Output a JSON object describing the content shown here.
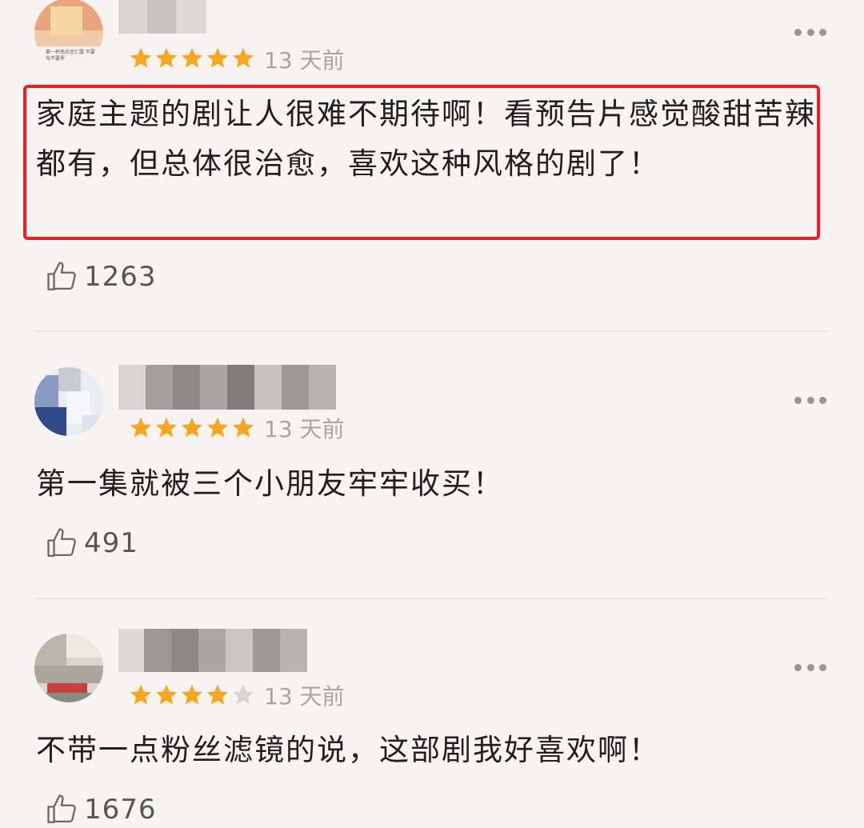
{
  "reviews": [
    {
      "rating": 5,
      "time": "13 天前",
      "text": "家庭主题的剧让人很难不期待啊！看预告片感觉酸甜苦辣都有，但总体很治愈，喜欢这种风格的剧了！",
      "likes": "1263",
      "avatar_caption": "第一杯南瓜杏仁露 不要告不要罗",
      "highlighted": true
    },
    {
      "rating": 5,
      "time": "13 天前",
      "text": "第一集就被三个小朋友牢牢收买！",
      "likes": "491",
      "highlighted": false
    },
    {
      "rating": 4,
      "time": "13 天前",
      "text": "不带一点粉丝滤镜的说，这部剧我好喜欢啊！",
      "likes": "1676",
      "highlighted": false
    }
  ],
  "icons": {
    "star_filled": "star-filled-icon",
    "star_empty": "star-empty-icon",
    "like": "thumbs-up-icon",
    "more": "more-dots-icon"
  },
  "colors": {
    "star": "#f7a621",
    "star_empty": "#d9d4d4",
    "highlight_border": "#ee1c25",
    "background": "#f8f3f3"
  }
}
